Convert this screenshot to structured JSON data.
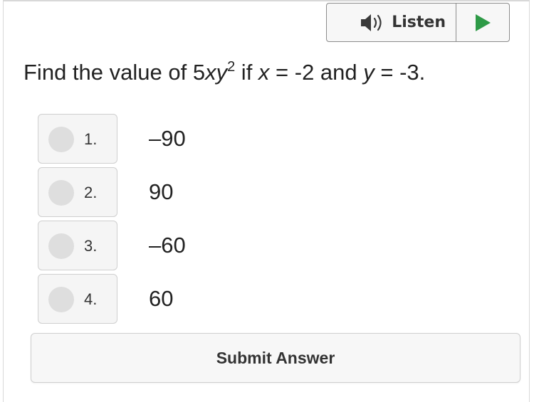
{
  "listen": {
    "label": "Listen",
    "speaker_icon": "speaker-icon",
    "play_icon": "play-icon",
    "play_color": "#2e9a47"
  },
  "question": {
    "prefix": "Find the value of 5",
    "expr_x": "x",
    "expr_y": "y",
    "exponent": "2",
    "if_text": " if ",
    "var_x": "x",
    "eq_x": " = -2 and ",
    "var_y": "y",
    "eq_y": " = -3."
  },
  "options": [
    {
      "number": "1.",
      "value": "–90"
    },
    {
      "number": "2.",
      "value": "90"
    },
    {
      "number": "3.",
      "value": "–60"
    },
    {
      "number": "4.",
      "value": "60"
    }
  ],
  "submit": {
    "label": "Submit Answer"
  }
}
